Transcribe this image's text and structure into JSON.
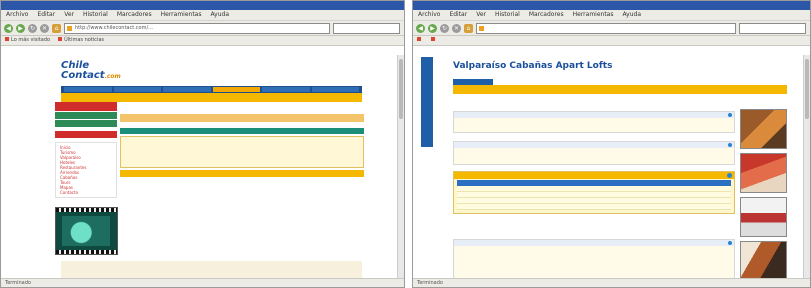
{
  "left_window": {
    "title": "",
    "menu": [
      "Archivo",
      "Editar",
      "Ver",
      "Historial",
      "Marcadores",
      "Herramientas",
      "Ayuda"
    ],
    "url": "http://www.chilecontact.com/...",
    "search_placeholder": "",
    "bookmarks": [
      "Lo más visitado",
      "Últimas noticias"
    ],
    "status": "Terminado",
    "site": {
      "logo_main": "Chile",
      "logo_sub": "Contact",
      "logo_tld": ".com",
      "nav": [
        "",
        "",
        "",
        "",
        "",
        ""
      ],
      "strip_text": "",
      "side_header": "",
      "side_green": [
        "",
        ""
      ],
      "side_links": [
        "Inicio",
        "Turismo",
        "Valparaíso",
        "Hoteles",
        "Restaurantes",
        "Arriendos",
        "Cabañas",
        "Tours",
        "Mapas",
        "Contacto"
      ],
      "side_header2": "",
      "crumb": "",
      "box_title": "",
      "box_desc": "",
      "footer_lines": [
        "",
        "",
        ""
      ]
    }
  },
  "right_window": {
    "title": "",
    "menu": [
      "Archivo",
      "Editar",
      "Ver",
      "Historial",
      "Marcadores",
      "Herramientas",
      "Ayuda"
    ],
    "url": "",
    "search_placeholder": "",
    "bookmarks": [
      "",
      ""
    ],
    "status": "Terminado",
    "site": {
      "sidebar_label": "",
      "title": "Valparaíso Cabañas Apart Lofts",
      "subtitle": "",
      "tab": "",
      "strip_text": "",
      "crumb": "",
      "section_description": {
        "heading": "",
        "text": ""
      },
      "section_details": {
        "heading": "",
        "text": ""
      },
      "table": {
        "heading": "",
        "columns": [
          "",
          "",
          "",
          ""
        ],
        "rows": [
          [
            "",
            "",
            "",
            ""
          ],
          [
            "",
            "",
            "",
            ""
          ],
          [
            "",
            "",
            "",
            ""
          ],
          [
            "",
            "",
            "",
            ""
          ]
        ],
        "note": ""
      },
      "section_more": {
        "heading": "",
        "text": ""
      }
    }
  }
}
